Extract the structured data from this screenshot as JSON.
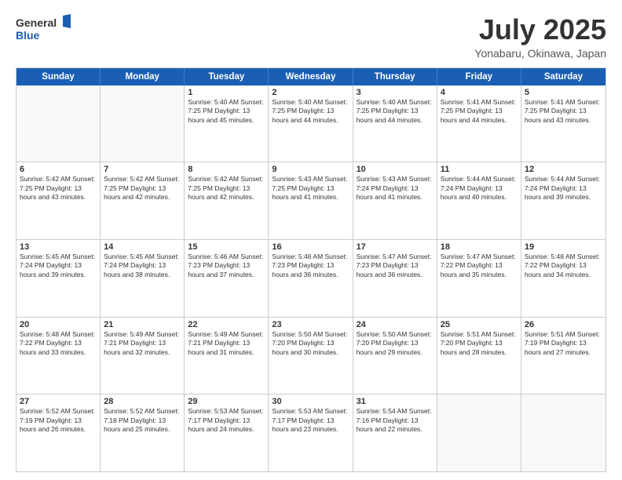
{
  "logo": {
    "line1": "General",
    "line2": "Blue"
  },
  "title": "July 2025",
  "location": "Yonabaru, Okinawa, Japan",
  "header_days": [
    "Sunday",
    "Monday",
    "Tuesday",
    "Wednesday",
    "Thursday",
    "Friday",
    "Saturday"
  ],
  "rows": [
    [
      {
        "day": "",
        "text": "",
        "empty": true
      },
      {
        "day": "",
        "text": "",
        "empty": true
      },
      {
        "day": "1",
        "text": "Sunrise: 5:40 AM\nSunset: 7:25 PM\nDaylight: 13 hours and 45 minutes."
      },
      {
        "day": "2",
        "text": "Sunrise: 5:40 AM\nSunset: 7:25 PM\nDaylight: 13 hours and 44 minutes."
      },
      {
        "day": "3",
        "text": "Sunrise: 5:40 AM\nSunset: 7:25 PM\nDaylight: 13 hours and 44 minutes."
      },
      {
        "day": "4",
        "text": "Sunrise: 5:41 AM\nSunset: 7:25 PM\nDaylight: 13 hours and 44 minutes."
      },
      {
        "day": "5",
        "text": "Sunrise: 5:41 AM\nSunset: 7:25 PM\nDaylight: 13 hours and 43 minutes."
      }
    ],
    [
      {
        "day": "6",
        "text": "Sunrise: 5:42 AM\nSunset: 7:25 PM\nDaylight: 13 hours and 43 minutes."
      },
      {
        "day": "7",
        "text": "Sunrise: 5:42 AM\nSunset: 7:25 PM\nDaylight: 13 hours and 42 minutes."
      },
      {
        "day": "8",
        "text": "Sunrise: 5:42 AM\nSunset: 7:25 PM\nDaylight: 13 hours and 42 minutes."
      },
      {
        "day": "9",
        "text": "Sunrise: 5:43 AM\nSunset: 7:25 PM\nDaylight: 13 hours and 41 minutes."
      },
      {
        "day": "10",
        "text": "Sunrise: 5:43 AM\nSunset: 7:24 PM\nDaylight: 13 hours and 41 minutes."
      },
      {
        "day": "11",
        "text": "Sunrise: 5:44 AM\nSunset: 7:24 PM\nDaylight: 13 hours and 40 minutes."
      },
      {
        "day": "12",
        "text": "Sunrise: 5:44 AM\nSunset: 7:24 PM\nDaylight: 13 hours and 39 minutes."
      }
    ],
    [
      {
        "day": "13",
        "text": "Sunrise: 5:45 AM\nSunset: 7:24 PM\nDaylight: 13 hours and 39 minutes."
      },
      {
        "day": "14",
        "text": "Sunrise: 5:45 AM\nSunset: 7:24 PM\nDaylight: 13 hours and 38 minutes."
      },
      {
        "day": "15",
        "text": "Sunrise: 5:46 AM\nSunset: 7:23 PM\nDaylight: 13 hours and 37 minutes."
      },
      {
        "day": "16",
        "text": "Sunrise: 5:46 AM\nSunset: 7:23 PM\nDaylight: 13 hours and 36 minutes."
      },
      {
        "day": "17",
        "text": "Sunrise: 5:47 AM\nSunset: 7:23 PM\nDaylight: 13 hours and 36 minutes."
      },
      {
        "day": "18",
        "text": "Sunrise: 5:47 AM\nSunset: 7:22 PM\nDaylight: 13 hours and 35 minutes."
      },
      {
        "day": "19",
        "text": "Sunrise: 5:48 AM\nSunset: 7:22 PM\nDaylight: 13 hours and 34 minutes."
      }
    ],
    [
      {
        "day": "20",
        "text": "Sunrise: 5:48 AM\nSunset: 7:22 PM\nDaylight: 13 hours and 33 minutes."
      },
      {
        "day": "21",
        "text": "Sunrise: 5:49 AM\nSunset: 7:21 PM\nDaylight: 13 hours and 32 minutes."
      },
      {
        "day": "22",
        "text": "Sunrise: 5:49 AM\nSunset: 7:21 PM\nDaylight: 13 hours and 31 minutes."
      },
      {
        "day": "23",
        "text": "Sunrise: 5:50 AM\nSunset: 7:20 PM\nDaylight: 13 hours and 30 minutes."
      },
      {
        "day": "24",
        "text": "Sunrise: 5:50 AM\nSunset: 7:20 PM\nDaylight: 13 hours and 29 minutes."
      },
      {
        "day": "25",
        "text": "Sunrise: 5:51 AM\nSunset: 7:20 PM\nDaylight: 13 hours and 28 minutes."
      },
      {
        "day": "26",
        "text": "Sunrise: 5:51 AM\nSunset: 7:19 PM\nDaylight: 13 hours and 27 minutes."
      }
    ],
    [
      {
        "day": "27",
        "text": "Sunrise: 5:52 AM\nSunset: 7:19 PM\nDaylight: 13 hours and 26 minutes."
      },
      {
        "day": "28",
        "text": "Sunrise: 5:52 AM\nSunset: 7:18 PM\nDaylight: 13 hours and 25 minutes."
      },
      {
        "day": "29",
        "text": "Sunrise: 5:53 AM\nSunset: 7:17 PM\nDaylight: 13 hours and 24 minutes."
      },
      {
        "day": "30",
        "text": "Sunrise: 5:53 AM\nSunset: 7:17 PM\nDaylight: 13 hours and 23 minutes."
      },
      {
        "day": "31",
        "text": "Sunrise: 5:54 AM\nSunset: 7:16 PM\nDaylight: 13 hours and 22 minutes."
      },
      {
        "day": "",
        "text": "",
        "empty": true
      },
      {
        "day": "",
        "text": "",
        "empty": true
      }
    ]
  ]
}
